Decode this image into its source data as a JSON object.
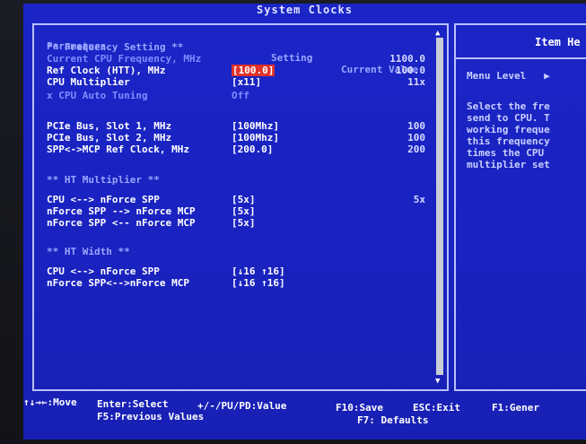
{
  "title": "System Clocks",
  "columns": {
    "parameters": "Parameters",
    "setting": "Setting",
    "current": "Current Value"
  },
  "rows": [
    {
      "label": "** Frequency Setting **",
      "setting": "",
      "current": "",
      "style": "hdr"
    },
    {
      "label": "Current CPU Frequency, MHz",
      "setting": "",
      "current": "1100.0",
      "style": "dim"
    },
    {
      "label": "Ref Clock (HTT), MHz",
      "setting": "[100.0]",
      "current": "100.0",
      "style": "selected"
    },
    {
      "label": "CPU Multiplier",
      "setting": "[x11]",
      "current": "11x",
      "style": ""
    },
    {
      "label": "x CPU Auto Tuning",
      "setting": "Off",
      "current": "",
      "style": "dim"
    },
    {
      "label": "PCIe Bus, Slot 1, MHz",
      "setting": "[100Mhz]",
      "current": "100",
      "style": ""
    },
    {
      "label": "PCIe Bus, Slot 2, MHz",
      "setting": "[100Mhz]",
      "current": "100",
      "style": ""
    },
    {
      "label": "SPP<->MCP Ref Clock, MHz",
      "setting": "[200.0]",
      "current": "200",
      "style": ""
    },
    {
      "label": "** HT Multiplier **",
      "setting": "",
      "current": "",
      "style": "hdr"
    },
    {
      "label": "CPU <--> nForce SPP",
      "setting": "[5x]",
      "current": "5x",
      "style": ""
    },
    {
      "label": "nForce SPP --> nForce MCP",
      "setting": "[5x]",
      "current": "",
      "style": ""
    },
    {
      "label": "nForce SPP <-- nForce MCP",
      "setting": "[5x]",
      "current": "",
      "style": ""
    },
    {
      "label": "** HT Width **",
      "setting": "",
      "current": "",
      "style": "hdr"
    },
    {
      "label": "CPU <--> nForce SPP",
      "setting": "[↓16 ↑16]",
      "current": "",
      "style": ""
    },
    {
      "label": "nForce SPP<-->nForce MCP",
      "setting": "[↓16 ↑16]",
      "current": "",
      "style": ""
    }
  ],
  "help": {
    "title": "Item He",
    "menu_level": "Menu Level   ▶",
    "lines": [
      "Select the fre",
      "send to CPU. T",
      "working freque",
      "this frequency",
      "times the CPU",
      "multiplier set"
    ]
  },
  "footer": {
    "move": "↑↓→←:Move",
    "enter": "Enter:Select",
    "value": "+/-/PU/PD:Value",
    "save": "F10:Save",
    "exit": "ESC:Exit",
    "general": "F1:Gener",
    "prev": "F5:Previous Values",
    "defaults": "F7: Defaults"
  },
  "colors": {
    "screen": "#1a22c2",
    "highlight": "#e0312a",
    "border": "#b8c0ff"
  }
}
